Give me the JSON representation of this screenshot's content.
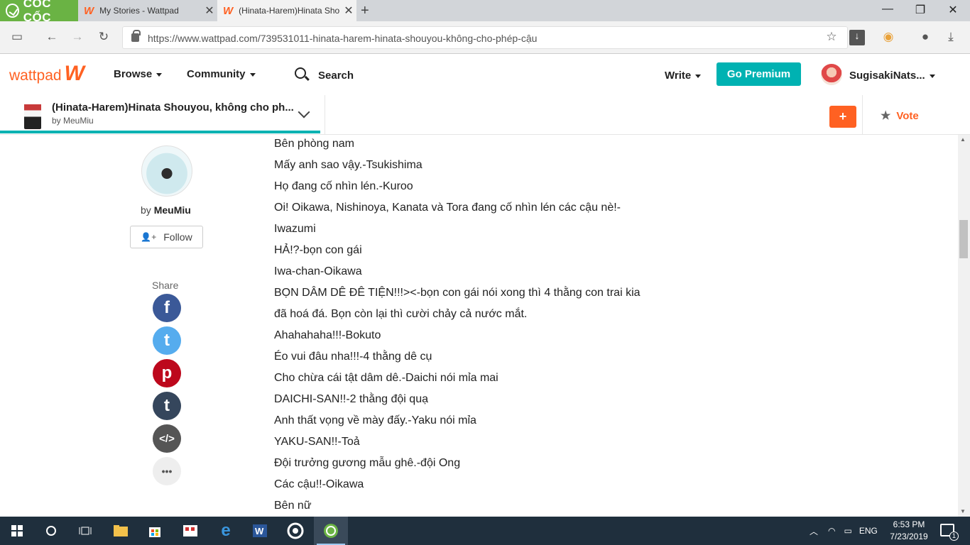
{
  "browser": {
    "brand": "CỐC CỐC",
    "tabs": [
      {
        "title": "My Stories - Wattpad"
      },
      {
        "title": "(Hinata-Harem)Hinata Sho"
      }
    ],
    "url": "https://www.wattpad.com/739531011-hinata-harem-hinata-shouyou-không-cho-phép-cậu"
  },
  "header": {
    "logo": "wattpad",
    "browse": "Browse",
    "community": "Community",
    "search": "Search",
    "write": "Write",
    "premium": "Go Premium",
    "username": "SugisakiNats..."
  },
  "story": {
    "title": "(Hinata-Harem)Hinata Shouyou, không cho ph...",
    "by": "by MeuMiu",
    "add": "+",
    "vote": "Vote",
    "progress": 0.33
  },
  "author": {
    "by": "by",
    "name": "MeuMiu",
    "follow": "Follow"
  },
  "share": {
    "label": "Share",
    "buttons": [
      {
        "name": "facebook",
        "glyph": "f",
        "color": "#3b5998"
      },
      {
        "name": "twitter",
        "glyph": "t",
        "color": "#55acee"
      },
      {
        "name": "pinterest",
        "glyph": "p",
        "color": "#bd081c"
      },
      {
        "name": "tumblr",
        "glyph": "t",
        "color": "#35465c"
      },
      {
        "name": "embed",
        "glyph": "</>",
        "color": "#555555"
      },
      {
        "name": "more",
        "glyph": "•••",
        "color": "#eeeeee"
      }
    ]
  },
  "text_lines": [
    "Bên phòng nam",
    "Mấy anh sao vậy.-Tsukishima",
    "Họ đang cố nhìn lén.-Kuroo",
    "Oi! Oikawa, Nishinoya, Kanata và Tora đang cố nhìn lén các cậu nè!-",
    "Iwazumi",
    "HẢ!?-bọn con gái",
    "Iwa-chan-Oikawa",
    "BỌN DÂM DÊ ĐÊ TIỆN!!!><-bọn con gái nói xong thì 4 thằng con trai kia",
    "đã hoá đá. Bọn còn lại thì cười chảy cả nước mắt.",
    "Ahahahaha!!!-Bokuto",
    "Éo vui đâu nha!!!-4 thằng dê cụ",
    "Cho chừa cái tật dâm dê.-Daichi nói mỉa mai",
    "DAICHI-SAN!!-2 thằng đội quạ",
    "Anh thất vọng về mày đấy.-Yaku nói mỉa",
    "YAKU-SAN!!-Toả",
    "Đội trưởng gương mẫu ghê.-đội Ong",
    "Các cậu!!-Oikawa",
    "Bên nữ"
  ],
  "taskbar": {
    "tray_lang": "ENG",
    "time": "6:53 PM",
    "date": "7/23/2019",
    "notifications": "1"
  },
  "colors": {
    "accent": "#ff6122",
    "premium": "#00b2b2",
    "cocccoc": "#6ab344"
  }
}
